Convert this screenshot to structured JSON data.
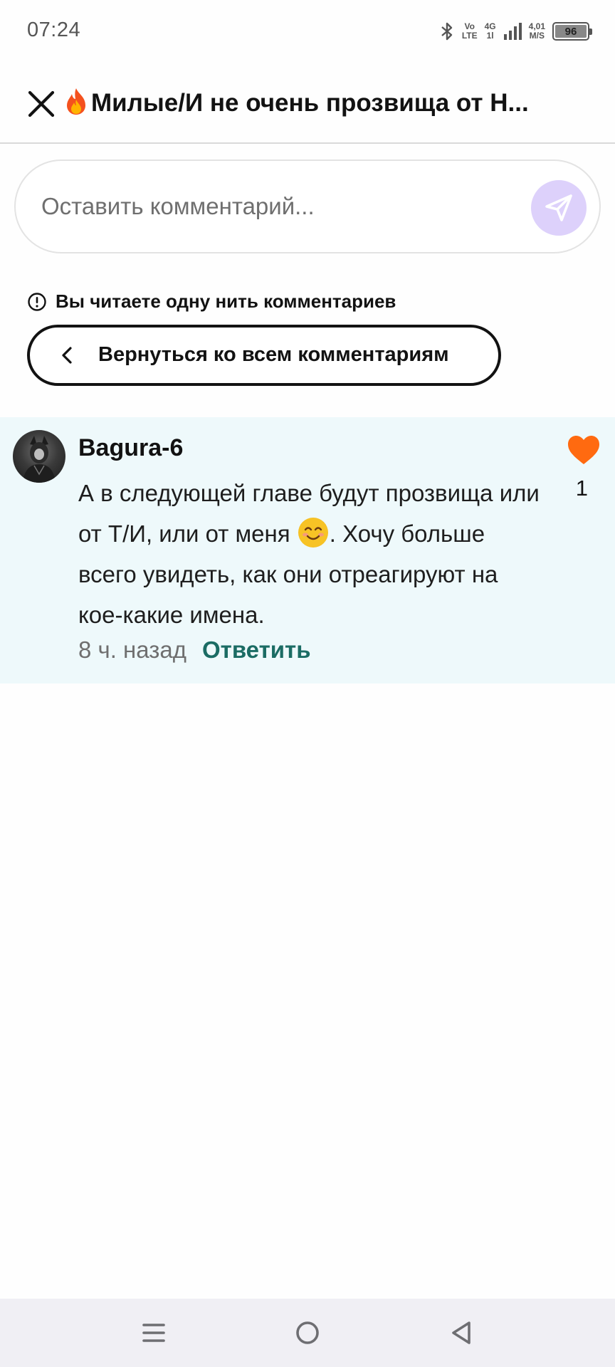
{
  "status_bar": {
    "time": "07:24",
    "network_top": "Vo",
    "network_bottom": "LTE",
    "gen_top": "4G",
    "gen_bottom": "1l",
    "speed_top": "4,01",
    "speed_bottom": "M/S",
    "battery": "96"
  },
  "header": {
    "title": "Милые/И не очень прозвища от Н..."
  },
  "comment_input": {
    "placeholder": "Оставить комментарий..."
  },
  "thread": {
    "notice": "Вы читаете одну нить комментариев",
    "back_label": "Вернуться ко всем комментариям"
  },
  "comment": {
    "username": "Bagura-6",
    "text_before_emoji": "А в следующей главе будут прозвища или от Т/И, или от меня ",
    "text_after_emoji": ". Хочу больше всего увидеть, как они отреагируют на кое-какие имена.",
    "time": "8 ч. назад",
    "reply_label": "Ответить",
    "likes": "1",
    "like_color": "#ff6a10"
  },
  "colors": {
    "card_background": "#eef9fb",
    "reply_link": "#1b6c64",
    "send_button": "#ddd1fb"
  }
}
